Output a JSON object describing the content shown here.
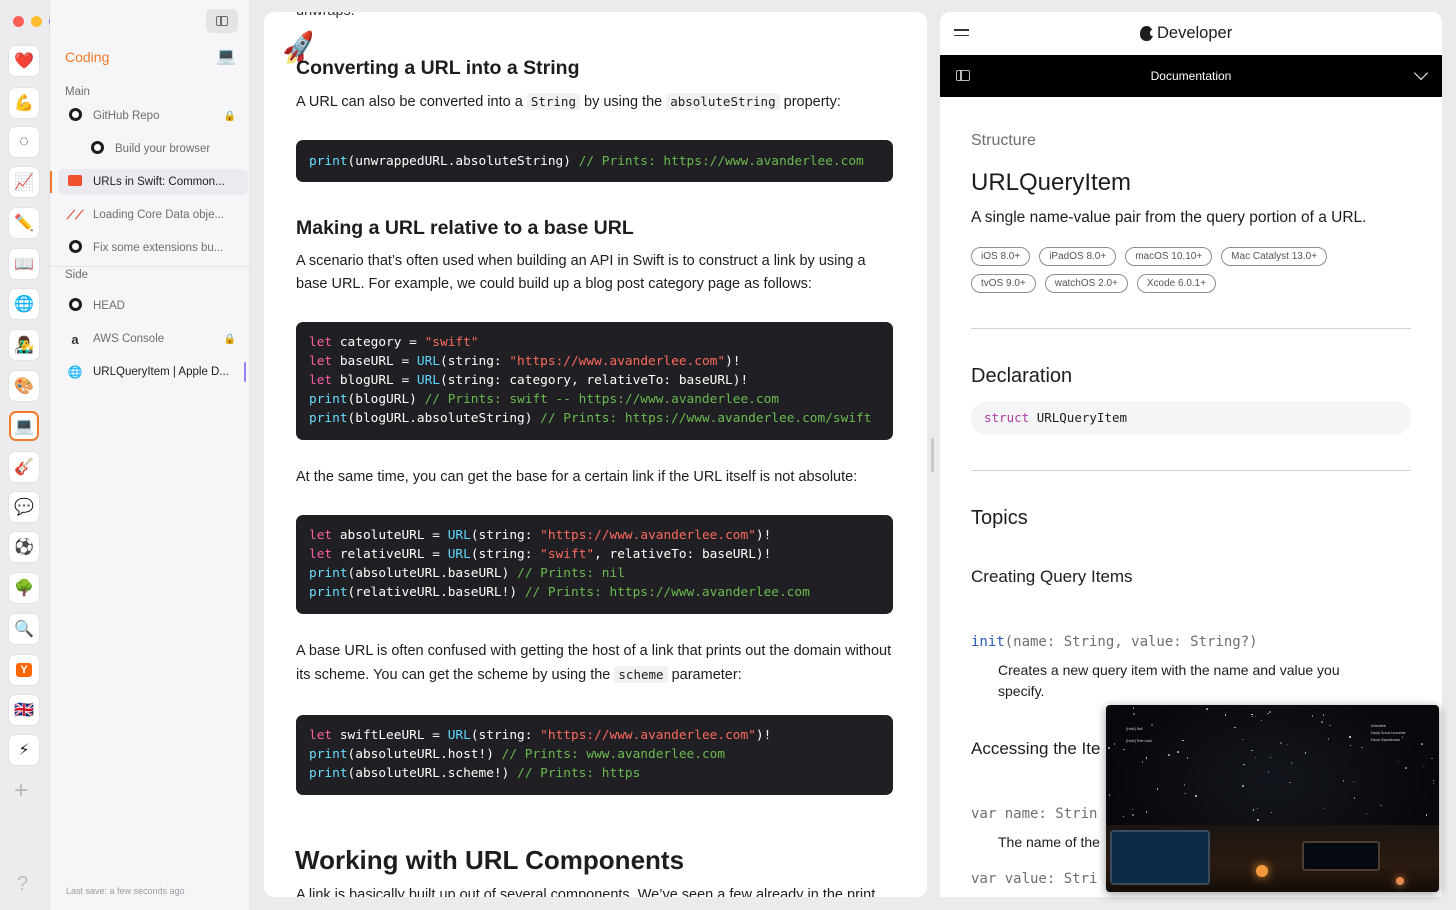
{
  "colors": {
    "accent": "#f07a2a",
    "traffic_close": "#fe5f57",
    "traffic_min": "#febc2e",
    "traffic_max": "#8b78e6",
    "selected_indicator": "#9c7ff0"
  },
  "rail": {
    "icons": [
      {
        "name": "heart-icon",
        "glyph": "❤️"
      },
      {
        "name": "strong-arm-icon",
        "glyph": "💪"
      },
      {
        "name": "loading-circle-icon",
        "glyph": "◌"
      },
      {
        "name": "chart-icon",
        "glyph": "📈"
      },
      {
        "name": "pencil-icon",
        "glyph": "✏️"
      },
      {
        "name": "book-icon",
        "glyph": "📖"
      },
      {
        "name": "globe-icon",
        "glyph": "🌐"
      },
      {
        "name": "pirate-icon",
        "glyph": "👨‍🎤"
      },
      {
        "name": "palette-icon",
        "glyph": "🎨"
      },
      {
        "name": "laptop-icon",
        "glyph": "💻"
      },
      {
        "name": "guitar-icon",
        "glyph": "🎸"
      },
      {
        "name": "speech-bubble-icon",
        "glyph": "💬"
      },
      {
        "name": "soccer-ball-icon",
        "glyph": "⚽"
      },
      {
        "name": "tree-icon",
        "glyph": "🌳"
      },
      {
        "name": "magnifier-icon",
        "glyph": "🔍"
      },
      {
        "name": "y-icon",
        "glyph": "Y"
      },
      {
        "name": "uk-flag-icon",
        "glyph": "🇬🇧"
      },
      {
        "name": "lightning-icon",
        "glyph": "⚡"
      }
    ],
    "plus": "+",
    "help": "?"
  },
  "sidebar": {
    "space_title": "Coding",
    "space_emoji": "💻",
    "main_label": "Main",
    "side_label": "Side",
    "main_items": [
      {
        "label": "GitHub Repo",
        "icon": "github-icon",
        "locked": true
      },
      {
        "label": "Build your browser",
        "icon": "github-icon",
        "locked": false
      },
      {
        "label": "URLs in Swift: Common...",
        "icon": "swiftlee-icon",
        "locked": false
      },
      {
        "label": "Loading Core Data obje...",
        "icon": "swiftlee-logo-icon",
        "locked": false
      },
      {
        "label": "Fix some extensions bu...",
        "icon": "github-icon",
        "locked": false
      }
    ],
    "side_items": [
      {
        "label": "HEAD",
        "icon": "github-icon",
        "locked": false
      },
      {
        "label": "AWS Console",
        "icon": "amazon-icon",
        "locked": true
      },
      {
        "label": "URLQueryItem | Apple D...",
        "icon": "globe-icon",
        "locked": false
      }
    ],
    "lock_glyph": "🔒",
    "last_save": "Last save: a few seconds ago"
  },
  "article": {
    "top_fragment": "unwraps.",
    "h_convert": "Converting a URL into a String",
    "p_convert_1": "A URL can also be converted into a",
    "p_convert_code1": "String",
    "p_convert_2": "by using the",
    "p_convert_code2": "absoluteString",
    "p_convert_3": "property:",
    "h_relative": "Making a URL relative to a base URL",
    "p_relative": "A scenario that’s often used when building an API in Swift is to construct a link by using a base URL. For example, we could build up a blog post category page as follows:",
    "p_base": "At the same time, you can get the base for a certain link if the URL itself is not absolute:",
    "p_host_1": "A base URL is often confused with getting the host of a link that prints out the domain without its scheme. You can get the scheme by using the",
    "p_host_code": "scheme",
    "p_host_2": "parameter:",
    "h_components": "Working with URL Components",
    "p_components": "A link is basically built up out of several components. We’ve seen a few already in the print"
  },
  "docs": {
    "brand": "Developer",
    "bar_title": "Documentation",
    "eyebrow": "Structure",
    "title": "URLQueryItem",
    "abstract": "A single name-value pair from the query portion of a URL.",
    "availability": [
      "iOS 8.0+",
      "iPadOS 8.0+",
      "macOS 10.10+",
      "Mac Catalyst 13.0+",
      "tvOS 9.0+",
      "watchOS 2.0+",
      "Xcode 6.0.1+"
    ],
    "declaration_heading": "Declaration",
    "declaration_keyword": "struct",
    "declaration_name": "URLQueryItem",
    "topics_heading": "Topics",
    "creating_heading": "Creating Query Items",
    "init_name": "init",
    "init_params": "(name: String, value: String?)",
    "init_desc": "Creates a new query item with the name and value you specify.",
    "accessing_heading": "Accessing the Ite",
    "var_name_label": "var name: Strin",
    "var_name_desc": "The name of the",
    "var_value_label": "var value: Stri"
  },
  "pip": {
    "hud_left_1": "[Hold] Roll",
    "hud_left_2": "[Hold] Free Look",
    "hud_right_1": "Unbuckle",
    "hud_right_2": "Equip Scout Launcher",
    "hud_right_3": "Equip Signalscope"
  }
}
